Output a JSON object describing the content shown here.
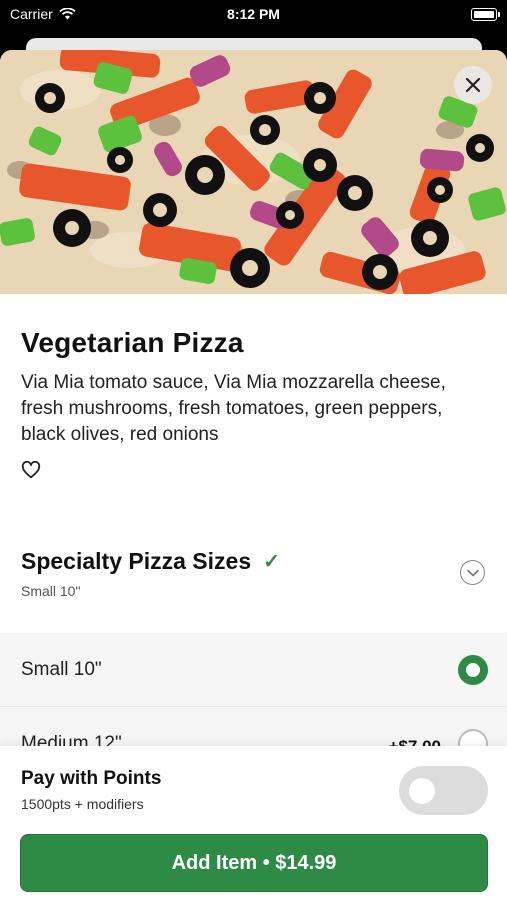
{
  "status_bar": {
    "carrier": "Carrier",
    "time": "8:12 PM"
  },
  "item": {
    "title": "Vegetarian Pizza",
    "description": "Via Mia tomato sauce, Via Mia mozzarella cheese, fresh mushrooms, fresh tomatoes, green peppers, black olives, red onions",
    "favorite_icon": "heart-outline-icon"
  },
  "sizes_section": {
    "title": "Specialty Pizza Sizes",
    "check_icon": "✓",
    "selected_summary": "Small 10\"",
    "options": [
      {
        "label": "Small 10\"",
        "price": "",
        "selected": true
      },
      {
        "label": "Medium 12\"",
        "price": "+$7.00",
        "selected": false
      }
    ]
  },
  "footer": {
    "pay_title": "Pay with Points",
    "pay_sub": "1500pts + modifiers",
    "pay_toggle_on": false,
    "add_button": "Add Item • $14.99"
  },
  "colors": {
    "accent": "#2e8b45"
  }
}
